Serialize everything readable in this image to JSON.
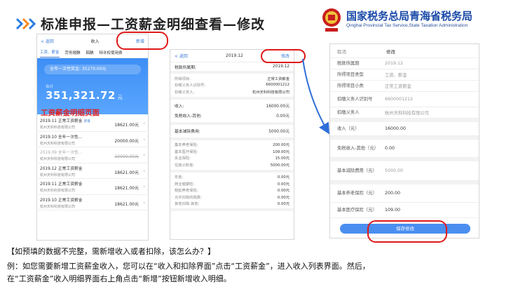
{
  "header": {
    "title": "标准申报—工资薪金明细查看—修改",
    "org_name": "国家税务总局青海省税务局",
    "org_sub": "Qinghai Provincial Tax Service,State Taxation Administration"
  },
  "phone1": {
    "back": "< 返回",
    "title": "收入",
    "add": "新增",
    "tabs": [
      "工资、薪金",
      "劳务报酬",
      "稿酬",
      "特许权使用费"
    ],
    "bonus_label": "全年一次性奖金: 35270.00元",
    "sum_label": "合计",
    "sum_value": "351,321.72",
    "sum_unit": "元",
    "page_label": "工资薪金明细页面",
    "rows": [
      {
        "t1": "2019.11 正常工资薪金",
        "new": "新增",
        "t2": "杭州天科科技有限公司",
        "amt": "18621.00元"
      },
      {
        "t1": "2019.10 全年一次性...",
        "new": "",
        "t2": "杭州天科科技有限公司",
        "amt": "20000.00元"
      },
      {
        "t1": "2019.09 全年一次性...",
        "new": "",
        "t2": "杭州天科科技有限公司",
        "amt": "10000.00元"
      },
      {
        "t1": "2019.12 正常工资薪金",
        "new": "",
        "t2": "杭州天科科技有限公司",
        "amt": "18621.00元"
      },
      {
        "t1": "2019.11 正常工资薪金",
        "new": "",
        "t2": "杭州天科科技有限公司",
        "amt": "18621.00元"
      },
      {
        "t1": "2019.10 正常工资薪金",
        "new": "",
        "t2": "杭州天科科技有限公司",
        "amt": "18621.00元"
      }
    ]
  },
  "phone2": {
    "back": "< 返回",
    "title": "2019.12",
    "edit": "修改",
    "period_label": "税款所属期:",
    "period_value": "2019.12",
    "info": [
      {
        "k": "所得项目:",
        "v": "正常工资薪金"
      },
      {
        "k": "扣缴义务人识别号:",
        "v": "6600001212"
      },
      {
        "k": "扣缴义务人:",
        "v": "杭州天科科技有限公司"
      }
    ],
    "income": [
      {
        "k": "收入:",
        "v": "16000.00元"
      },
      {
        "k": "免税收入-其他:",
        "v": "0.00元"
      }
    ],
    "deduct": [
      {
        "k": "基本减除费用:",
        "v": "5000.00元"
      }
    ],
    "special": [
      {
        "k": "基本养老保险:",
        "v": "200.00元"
      },
      {
        "k": "基本医疗保险:",
        "v": "109.00元"
      },
      {
        "k": "失业保险:",
        "v": "15.00元"
      },
      {
        "k": "住房公积金:",
        "v": "5000.00元"
      }
    ],
    "other": [
      {
        "k": "年金:",
        "v": "0.00元"
      },
      {
        "k": "商业健康险:",
        "v": "0.00元"
      },
      {
        "k": "税延养老保险:",
        "v": "0.00元"
      },
      {
        "k": "允许扣除的税费:",
        "v": "0.00元"
      },
      {
        "k": "其他扣除-其他:",
        "v": "0.00元"
      }
    ]
  },
  "phone3": {
    "cancel": "取消",
    "title": "修改",
    "rows": [
      {
        "k": "税款所属期",
        "v": "2019.12",
        "dark": false,
        "h": 16
      },
      {
        "k": "所得项目类型",
        "v": "工资、薪金",
        "dark": false,
        "h": 16
      },
      {
        "k": "所得项目小类",
        "v": "正常工资薪金",
        "dark": false,
        "h": 16
      },
      {
        "k": "扣缴义务人识别号",
        "v": "6600001212",
        "dark": false,
        "h": 22
      },
      {
        "k": "扣缴义务人",
        "v": "杭州天科科技有限公司",
        "dark": false,
        "h": 16
      }
    ],
    "rows2": [
      {
        "k": "收入（元）",
        "v": "16000.00",
        "dark": true,
        "h": 20
      }
    ],
    "rows3": [
      {
        "k": "免税收入-其他（元）",
        "v": "0.00",
        "dark": true,
        "h": 26
      }
    ],
    "rows4": [
      {
        "k": "基本减除费用（元）",
        "v": "5000.00",
        "dark": false,
        "h": 28
      }
    ],
    "rows5": [
      {
        "k": "基本养老保险（元）",
        "v": "200.00",
        "dark": true,
        "h": 26
      },
      {
        "k": "基本医疗保险（元）",
        "v": "109.00",
        "dark": true,
        "h": 22
      }
    ],
    "save": "保存修改"
  },
  "footer": {
    "question": "【如预填的数据不完整，需新增收入或者扣除，该怎么办？】",
    "answer1": "例：如您需要新增工资薪金收入，您可以在“收入和扣除界面”点击“工资薪金”，进入收入列表界面。然后，",
    "answer2": "在“工资薪金”收入明细界面右上角点击“新增”按钮新增收入明细。"
  },
  "colors": {
    "accent": "#3a7bd5",
    "highlight": "#e01818",
    "brand": "#1a4aa8"
  }
}
